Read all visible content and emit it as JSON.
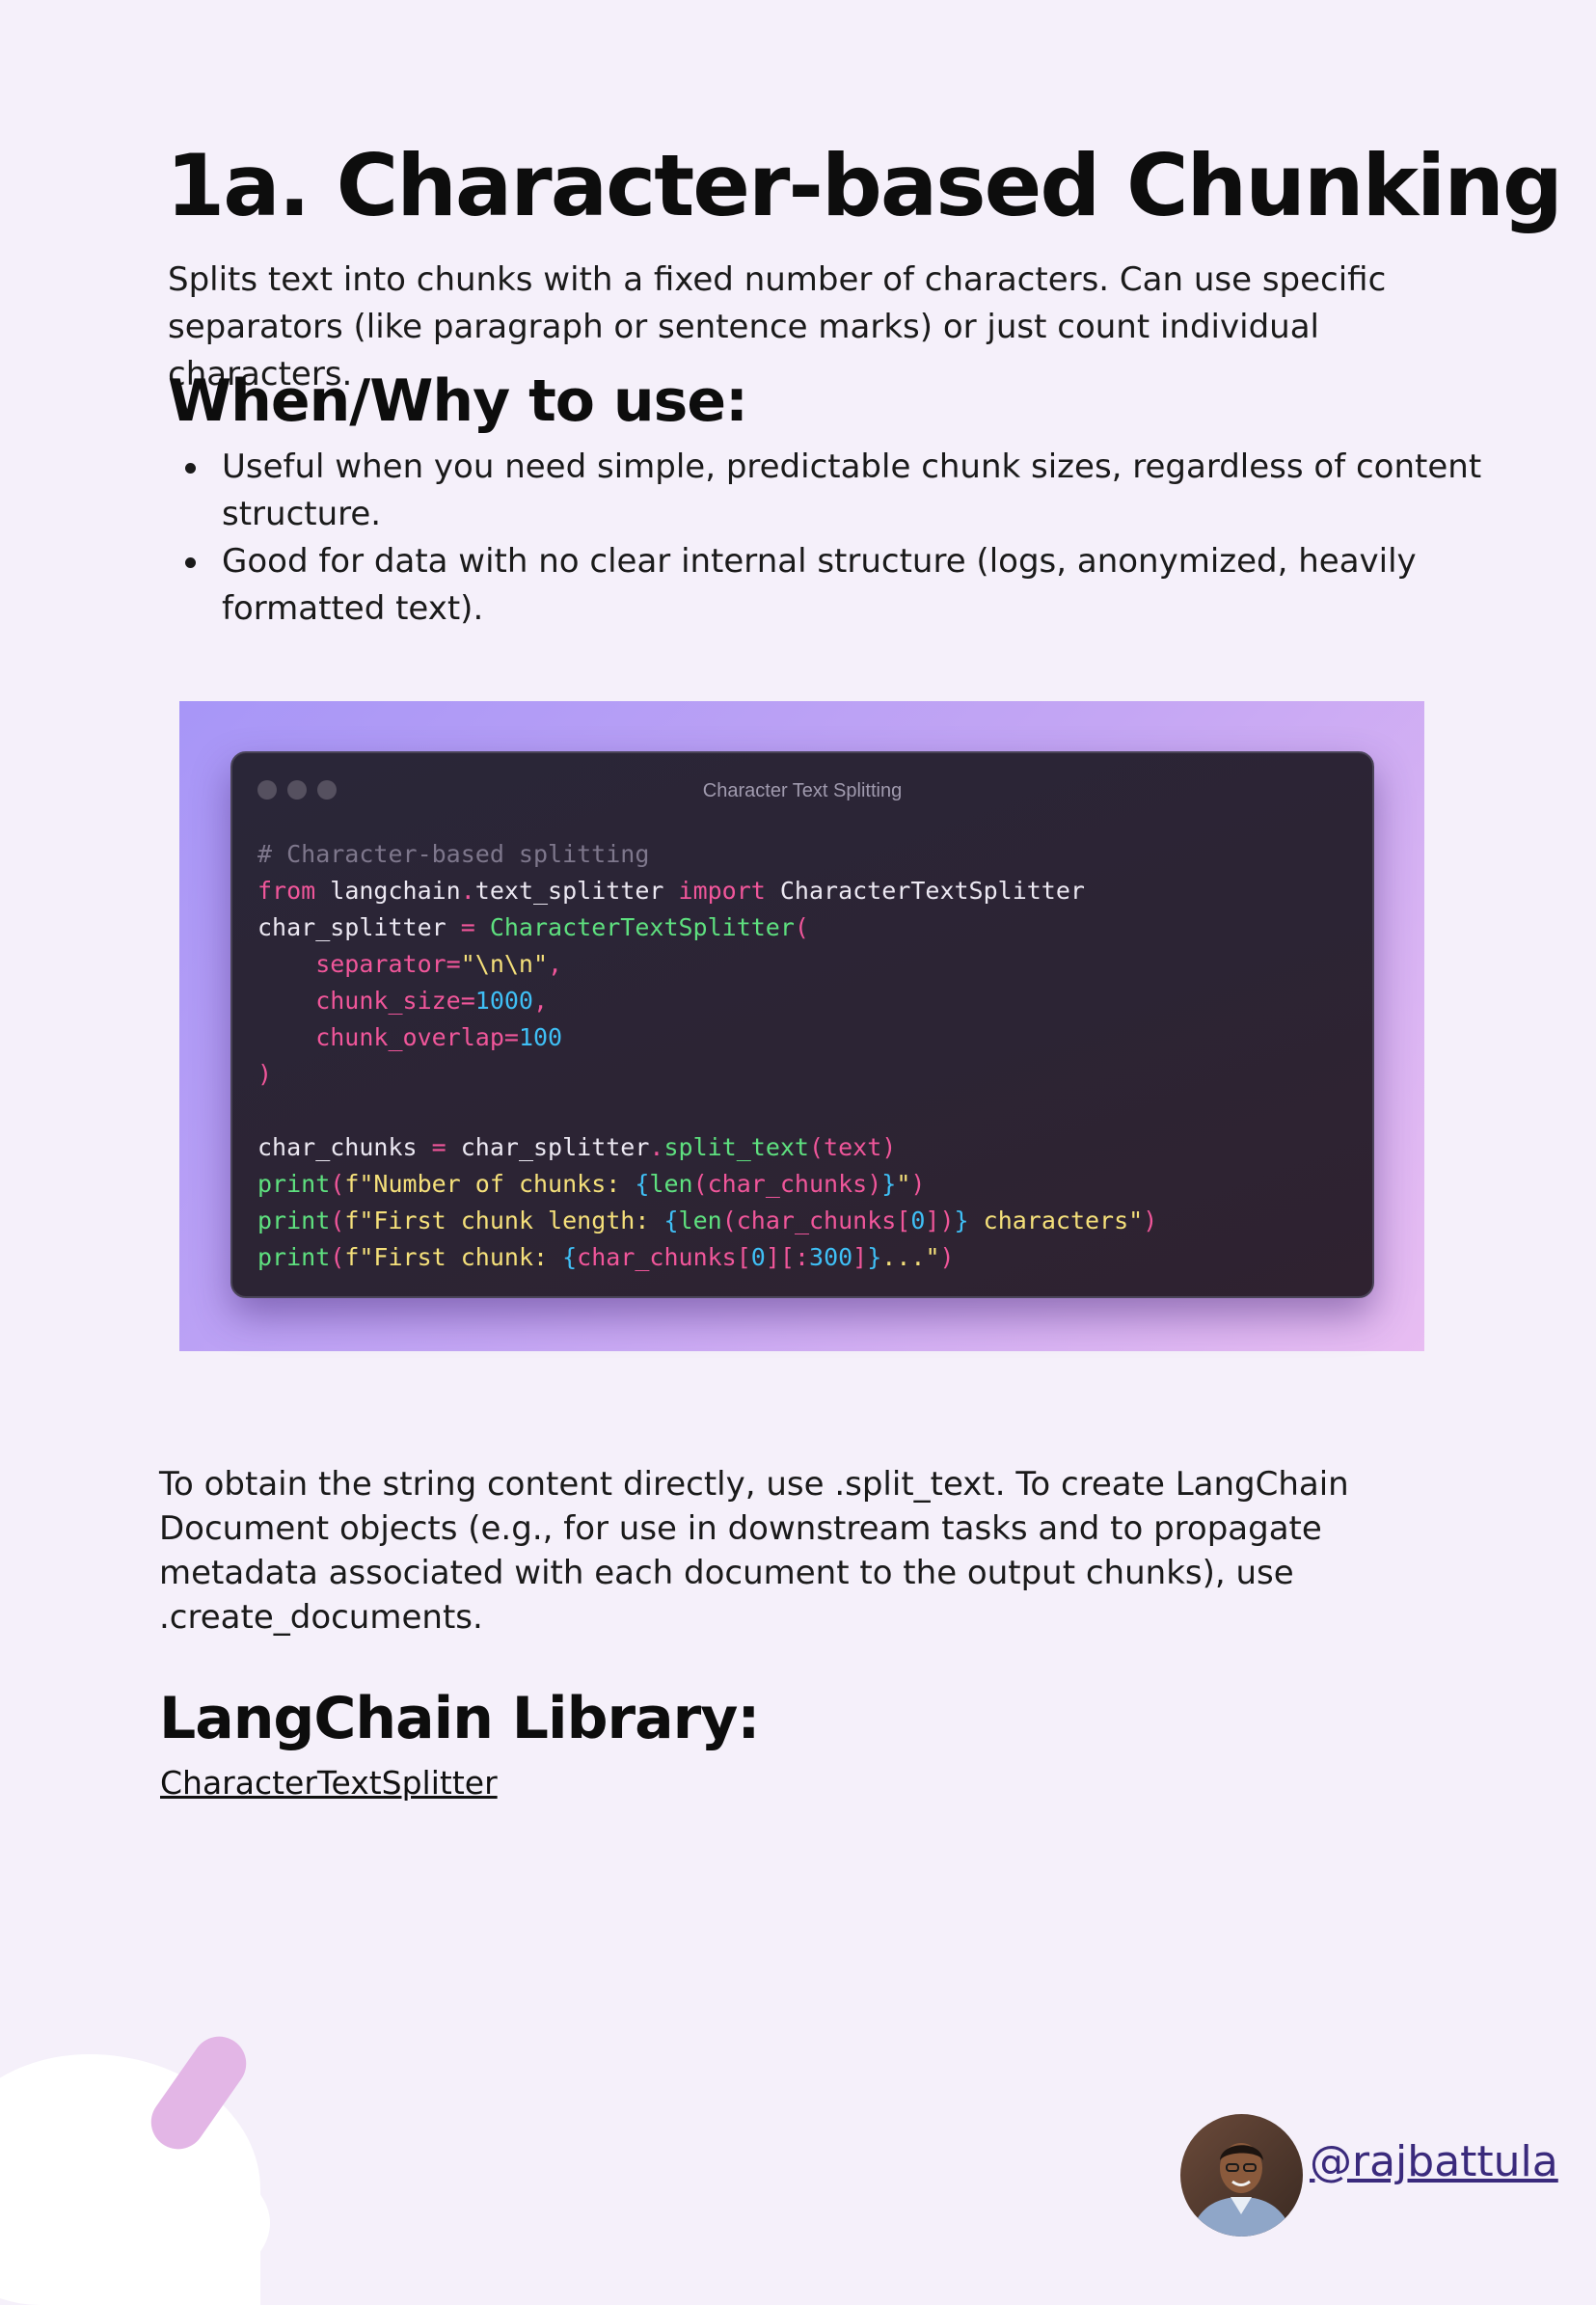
{
  "title": "1a. Character-based Chunking",
  "intro": "Splits text into chunks with a fixed number of characters. Can use specific separators (like paragraph or sentence marks) or just count individual characters.",
  "when_heading": "When/Why to use:",
  "bullets": [
    "Useful when you need simple, predictable chunk sizes, regardless of content structure.",
    "Good for data with no clear internal structure (logs, anonymized, heavily formatted text)."
  ],
  "code_window": {
    "title": "Character Text Splitting",
    "lines": [
      [
        {
          "t": "# Character-based splitting",
          "c": "comment"
        }
      ],
      [
        {
          "t": "from",
          "c": "kw"
        },
        {
          "t": " langchain",
          "c": "plain"
        },
        {
          "t": ".",
          "c": "op"
        },
        {
          "t": "text_splitter ",
          "c": "plain"
        },
        {
          "t": "import",
          "c": "kw"
        },
        {
          "t": " CharacterTextSplitter",
          "c": "plain"
        }
      ],
      [
        {
          "t": "char_splitter ",
          "c": "plain"
        },
        {
          "t": "=",
          "c": "op"
        },
        {
          "t": " CharacterTextSplitter",
          "c": "fn"
        },
        {
          "t": "(",
          "c": "pink"
        }
      ],
      [
        {
          "t": "    separator=",
          "c": "pink"
        },
        {
          "t": "\"\\n\\n\"",
          "c": "str"
        },
        {
          "t": ",",
          "c": "pink"
        }
      ],
      [
        {
          "t": "    chunk_size=",
          "c": "pink"
        },
        {
          "t": "1000",
          "c": "num"
        },
        {
          "t": ",",
          "c": "pink"
        }
      ],
      [
        {
          "t": "    chunk_overlap=",
          "c": "pink"
        },
        {
          "t": "100",
          "c": "num"
        }
      ],
      [
        {
          "t": ")",
          "c": "pink"
        }
      ],
      [],
      [
        {
          "t": "char_chunks ",
          "c": "plain"
        },
        {
          "t": "=",
          "c": "op"
        },
        {
          "t": " char_splitter",
          "c": "plain"
        },
        {
          "t": ".",
          "c": "op"
        },
        {
          "t": "split_text",
          "c": "call"
        },
        {
          "t": "(text)",
          "c": "pink"
        }
      ],
      [
        {
          "t": "print",
          "c": "call"
        },
        {
          "t": "(",
          "c": "pink"
        },
        {
          "t": "f\"Number of chunks: ",
          "c": "str"
        },
        {
          "t": "{",
          "c": "brace"
        },
        {
          "t": "len",
          "c": "exprfn"
        },
        {
          "t": "(char_chunks)",
          "c": "expr"
        },
        {
          "t": "}",
          "c": "brace"
        },
        {
          "t": "\"",
          "c": "str"
        },
        {
          "t": ")",
          "c": "pink"
        }
      ],
      [
        {
          "t": "print",
          "c": "call"
        },
        {
          "t": "(",
          "c": "pink"
        },
        {
          "t": "f\"First chunk length: ",
          "c": "str"
        },
        {
          "t": "{",
          "c": "brace"
        },
        {
          "t": "len",
          "c": "exprfn"
        },
        {
          "t": "(char_chunks[",
          "c": "expr"
        },
        {
          "t": "0",
          "c": "num"
        },
        {
          "t": "])",
          "c": "expr"
        },
        {
          "t": "}",
          "c": "brace"
        },
        {
          "t": " characters\"",
          "c": "str"
        },
        {
          "t": ")",
          "c": "pink"
        }
      ],
      [
        {
          "t": "print",
          "c": "call"
        },
        {
          "t": "(",
          "c": "pink"
        },
        {
          "t": "f\"First chunk: ",
          "c": "str"
        },
        {
          "t": "{",
          "c": "brace"
        },
        {
          "t": "char_chunks[",
          "c": "expr"
        },
        {
          "t": "0",
          "c": "num"
        },
        {
          "t": "][:",
          "c": "expr"
        },
        {
          "t": "300",
          "c": "num"
        },
        {
          "t": "]",
          "c": "expr"
        },
        {
          "t": "}",
          "c": "brace"
        },
        {
          "t": "...\"",
          "c": "str"
        },
        {
          "t": ")",
          "c": "pink"
        }
      ]
    ]
  },
  "paragraph": "To obtain the string content directly, use .split_text. To create LangChain Document objects (e.g., for use in downstream tasks and to propagate metadata associated with each document to the output chunks), use .create_documents.",
  "library_heading": "LangChain Library:",
  "library_link": "CharacterTextSplitter",
  "footer": {
    "handle": "@rajbattula"
  },
  "colors": {
    "background": "#f5f0fa",
    "code_bg_start": "#a796f7",
    "code_bg_end": "#e8bdf2",
    "window_bg": "#2a2638",
    "keyword": "#f0569a",
    "function": "#5ee07f",
    "string": "#f5e07a",
    "number": "#3fbff5",
    "handle": "#3a2a7c"
  },
  "icons": [
    "window-dot-icon",
    "avatar-photo",
    "pill-decoration"
  ]
}
